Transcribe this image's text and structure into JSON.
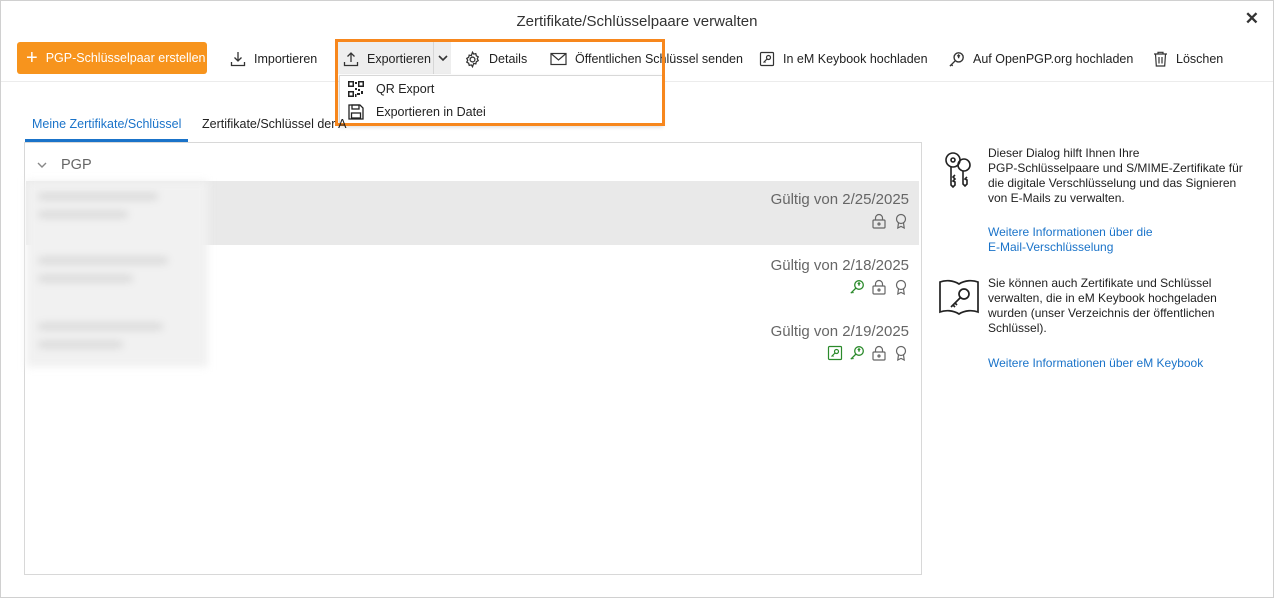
{
  "window": {
    "title": "Zertifikate/Schlüsselpaare verwalten",
    "close_glyph": "✕"
  },
  "toolbar": {
    "create_label": "PGP-Schlüsselpaar erstellen",
    "import_label": "Importieren",
    "export_label": "Exportieren",
    "details_label": "Details",
    "send_label": "Öffentlichen Schlüssel senden",
    "keybook_label": "In eM Keybook hochladen",
    "openpgp_label": "Auf OpenPGP.org hochladen",
    "delete_label": "Löschen",
    "accent_color": "#f7941d"
  },
  "export_menu": {
    "items": [
      {
        "label": "QR Export",
        "icon": "qr-code-icon"
      },
      {
        "label": "Exportieren in Datei",
        "icon": "save-file-icon"
      }
    ]
  },
  "tabs": [
    {
      "label": "Meine Zertifikate/Schlüssel",
      "active": true
    },
    {
      "label": "Zertifikate/Schlüssel der A",
      "active": false
    }
  ],
  "list": {
    "group": "PGP",
    "rows": [
      {
        "validity": "Gültig von 2/25/2025",
        "icons": [
          "lock-icon",
          "award-icon"
        ],
        "selected": true
      },
      {
        "validity": "Gültig von 2/18/2025",
        "icons": [
          "key-upload-icon",
          "lock-icon",
          "award-icon"
        ],
        "selected": false
      },
      {
        "validity": "Gültig von 2/19/2025",
        "icons": [
          "keybook-icon",
          "key-upload-icon",
          "lock-icon",
          "award-icon"
        ],
        "selected": false
      }
    ]
  },
  "side": {
    "info1": "Dieser Dialog hilft Ihnen Ihre PGP-Schlüsselpaare und S/MIME-Zertifikate für die digitale Verschlüsselung und das Signieren von E-Mails zu verwalten.",
    "info1_lines": [
      "Dieser Dialog hilft Ihnen Ihre",
      "PGP-Schlüsselpaare und S/MIME-Zertifikate für",
      "die digitale Verschlüsselung und das Signieren",
      "von E-Mails zu verwalten."
    ],
    "link1_lines": [
      "Weitere Informationen über die",
      "E-Mail-Verschlüsselung"
    ],
    "info2_lines": [
      "Sie können auch Zertifikate und Schlüssel",
      "verwalten, die in eM Keybook hochgeladen",
      "wurden (unser Verzeichnis der öffentlichen",
      "Schlüssel)."
    ],
    "link2": "Weitere Informationen über eM Keybook",
    "link_color": "#1a73c9"
  }
}
